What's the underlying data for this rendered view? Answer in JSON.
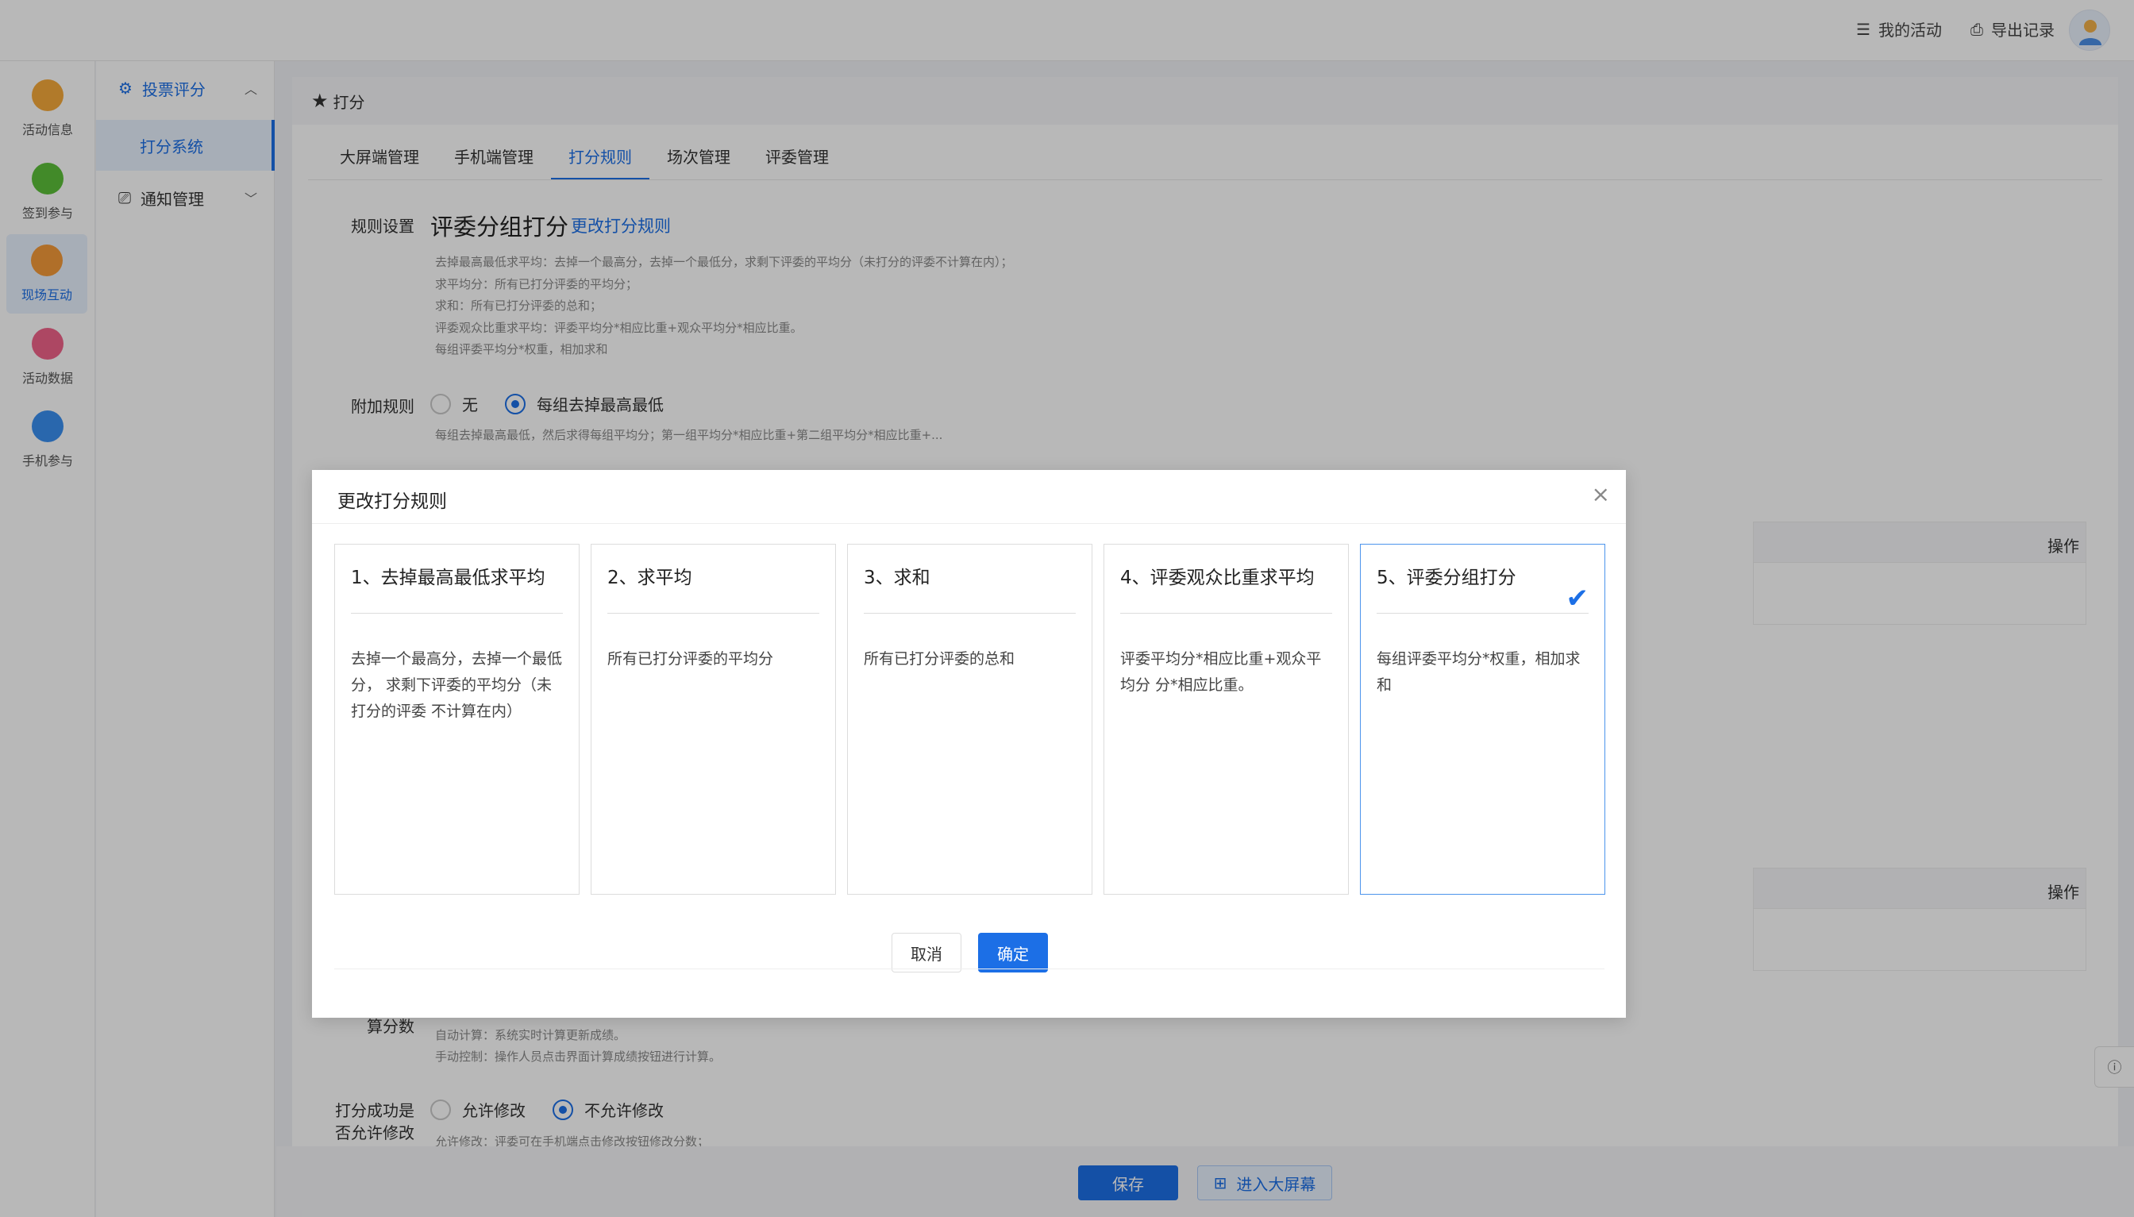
{
  "topbar": {
    "my_activities": "我的活动",
    "export_records": "导出记录"
  },
  "rail": {
    "items": [
      {
        "label": "活动信息",
        "icon": "activity-info-icon"
      },
      {
        "label": "签到参与",
        "icon": "checkin-icon"
      },
      {
        "label": "现场互动",
        "icon": "live-interaction-icon"
      },
      {
        "label": "活动数据",
        "icon": "activity-data-icon"
      },
      {
        "label": "手机参与",
        "icon": "mobile-participation-icon"
      }
    ]
  },
  "submenu": {
    "group1": "投票评分",
    "item1": "打分系统",
    "group2": "通知管理"
  },
  "main": {
    "header": "打分",
    "tabs": [
      "大屏端管理",
      "手机端管理",
      "打分规则",
      "场次管理",
      "评委管理"
    ],
    "rule_label": "规则设置",
    "rule_title": "评委分组打分",
    "rule_link": "更改打分规则",
    "desc_lines": [
      "去掉最高最低求平均：去掉一个最高分，去掉一个最低分，求剩下评委的平均分（未打分的评委不计算在内）；",
      "求平均分：所有已打分评委的平均分；",
      "求和：所有已打分评委的总和；",
      "评委观众比重求平均：评委平均分*相应比重+观众平均分*相应比重。",
      "每组评委平均分*权重，相加求和"
    ],
    "extra_label": "附加规则",
    "extra_options": [
      "无",
      "每组去掉最高最低"
    ],
    "extra_note": "每组去掉最高最低，然后求得每组平均分；第一组平均分*相应比重+第二组平均分*相应比重+...",
    "table_op": "操作",
    "calc_label": "算分数",
    "calc_note1": "自动计算：系统实时计算更新成绩。",
    "calc_note2": "手动控制：操作人员点击界面计算成绩按钮进行计算。",
    "modify_label1": "打分成功是",
    "modify_label2": "否允许修改",
    "modify_options": [
      "允许修改",
      "不允许修改"
    ],
    "modify_note": "允许修改：评委可在手机端点击修改按钮修改分数；"
  },
  "bottom": {
    "save": "保存",
    "enter_bigscreen": "进入大屏幕"
  },
  "modal": {
    "title": "更改打分规则",
    "cards": [
      {
        "title": "1、去掉最高最低求平均",
        "desc": "去掉一个最高分，去掉一个最低分， 求剩下评委的平均分（未打分的评委 不计算在内）"
      },
      {
        "title": "2、求平均",
        "desc": "所有已打分评委的平均分"
      },
      {
        "title": "3、求和",
        "desc": "所有已打分评委的总和"
      },
      {
        "title": "4、评委观众比重求平均",
        "desc": "评委平均分*相应比重+观众平均分 分*相应比重。"
      },
      {
        "title": "5、评委分组打分",
        "desc": "每组评委平均分*权重，相加求和"
      }
    ],
    "selected_index": 4,
    "check_mark": "✔",
    "cancel": "取消",
    "ok": "确定"
  },
  "colors": {
    "primary": "#1c6fe6",
    "selected_border": "#4c94ec"
  }
}
